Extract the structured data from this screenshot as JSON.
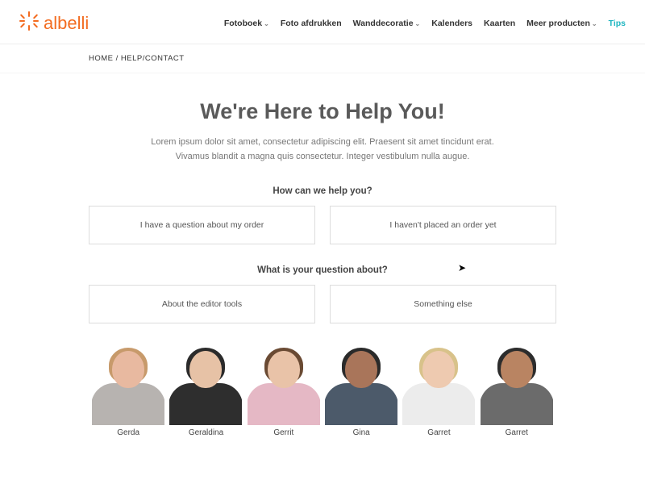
{
  "brand": {
    "name": "albelli"
  },
  "nav": {
    "items": [
      {
        "label": "Fotoboek",
        "hasChevron": true
      },
      {
        "label": "Foto afdrukken",
        "hasChevron": false
      },
      {
        "label": "Wanddecoratie",
        "hasChevron": true
      },
      {
        "label": "Kalenders",
        "hasChevron": false
      },
      {
        "label": "Kaarten",
        "hasChevron": false
      },
      {
        "label": "Meer producten",
        "hasChevron": true
      },
      {
        "label": "Tips",
        "hasChevron": false
      }
    ]
  },
  "breadcrumb": {
    "home": "HOME",
    "sep": " / ",
    "current": "HELP/CONTACT"
  },
  "hero": {
    "title": "We're Here to Help You!",
    "subtitle_line1": "Lorem ipsum dolor sit amet, consectetur adipiscing elit. Praesent sit amet tincidunt erat.",
    "subtitle_line2": "Vivamus blandit a magna quis consectetur. Integer vestibulum nulla augue."
  },
  "q1": {
    "label": "How can we help you?",
    "options": [
      "I have a question about my order",
      "I haven't placed an order yet"
    ]
  },
  "q2": {
    "label": "What is your question about?",
    "options": [
      "About the editor tools",
      "Something else"
    ]
  },
  "team": [
    {
      "name": "Gerda",
      "skin": "#e8b9a0",
      "hair": "#c79a6b",
      "shirt": "#b7b3b0"
    },
    {
      "name": "Geraldina",
      "skin": "#e7c2a6",
      "hair": "#2b2b2b",
      "shirt": "#2e2e2e"
    },
    {
      "name": "Gerrit",
      "skin": "#e9c3a8",
      "hair": "#6a4a33",
      "shirt": "#e5b8c5"
    },
    {
      "name": "Gina",
      "skin": "#a9755a",
      "hair": "#2a2a2a",
      "shirt": "#4c5a6a"
    },
    {
      "name": "Garret",
      "skin": "#eecab0",
      "hair": "#d8c28a",
      "shirt": "#ececec"
    },
    {
      "name": "Garret",
      "skin": "#b98462",
      "hair": "#2c2c2c",
      "shirt": "#6b6b6b"
    }
  ]
}
